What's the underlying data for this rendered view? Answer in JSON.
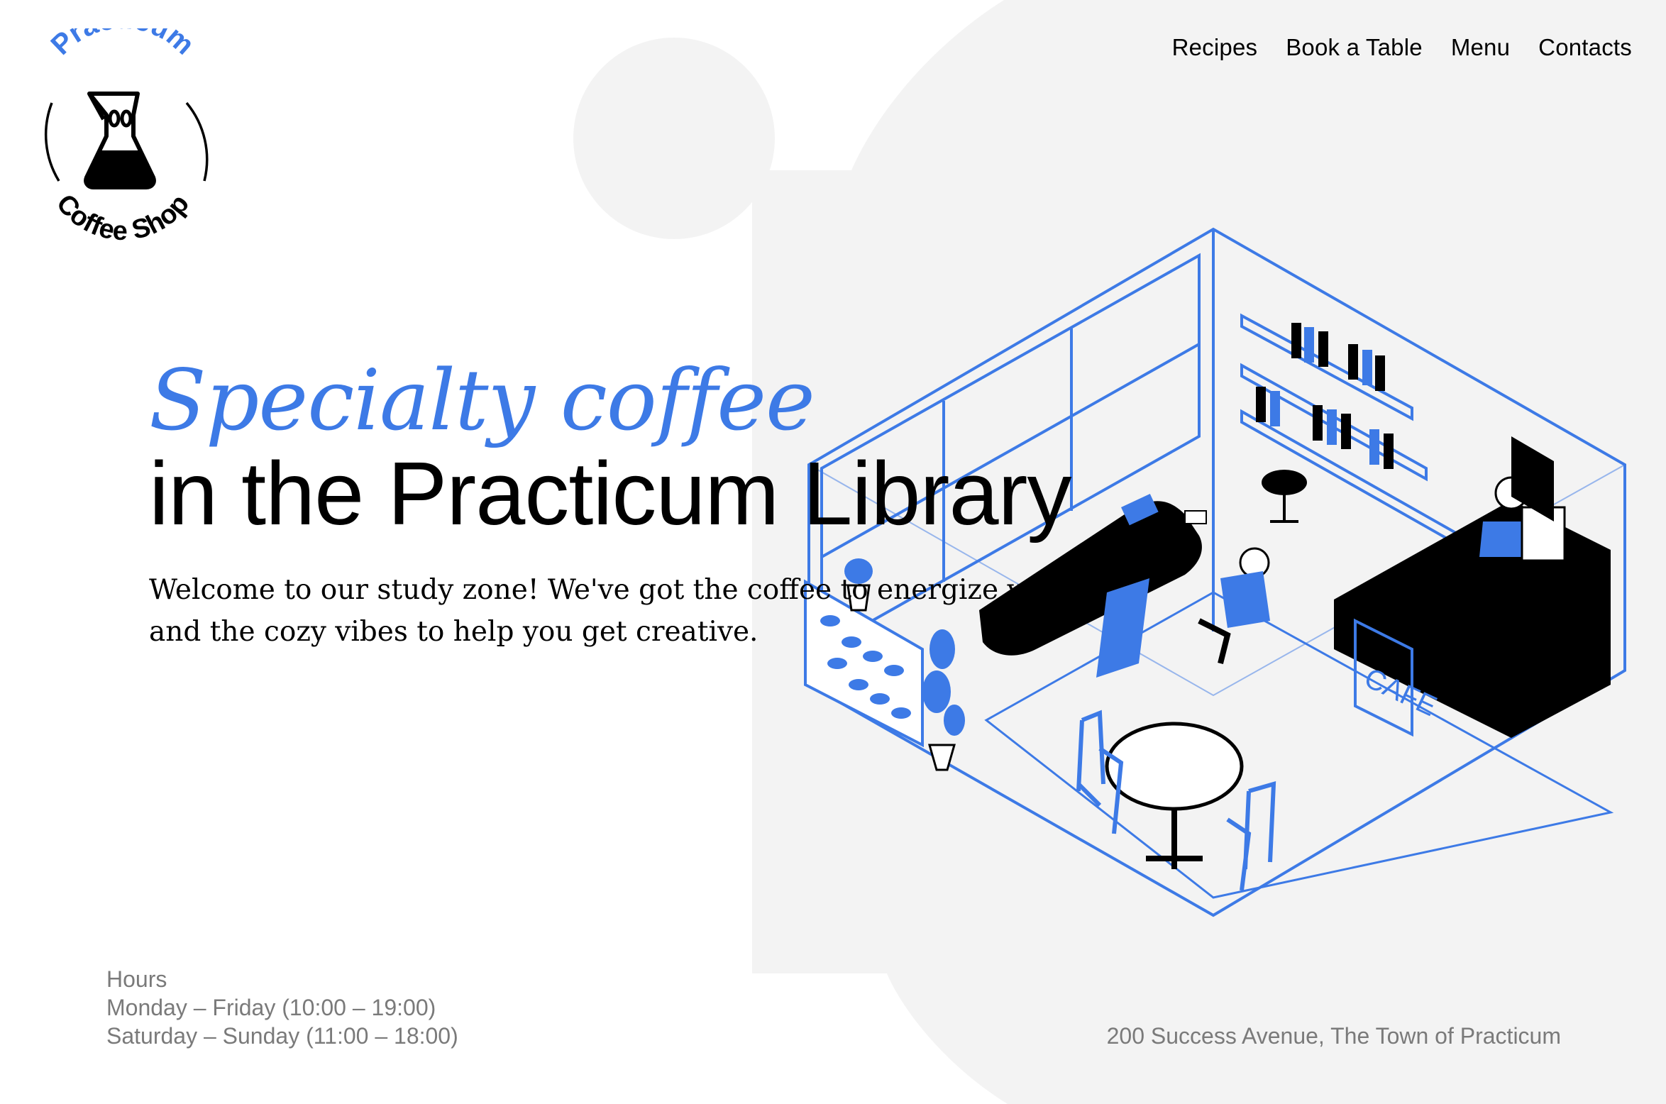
{
  "brand": {
    "logo_top": "Practicum",
    "logo_bottom": "Coffee Shop",
    "accent_color": "#3d7ae6"
  },
  "nav": {
    "items": [
      {
        "label": "Recipes"
      },
      {
        "label": "Book a Table"
      },
      {
        "label": "Menu"
      },
      {
        "label": "Contacts"
      }
    ]
  },
  "hero": {
    "accent": "Specialty coffee",
    "title": "in the Practicum Library",
    "description": "Welcome to our study zone! We've got the coffee to energize you and the cozy vibes to help you get creative."
  },
  "illustration": {
    "sign": "CAFE",
    "icon": "cafe-interior-illustration"
  },
  "hours": {
    "heading": "Hours",
    "weekdays": "Monday – Friday (10:00 – 19:00)",
    "weekend": "Saturday – Sunday (11:00 – 18:00)"
  },
  "address": "200 Success Avenue, The Town of Practicum"
}
